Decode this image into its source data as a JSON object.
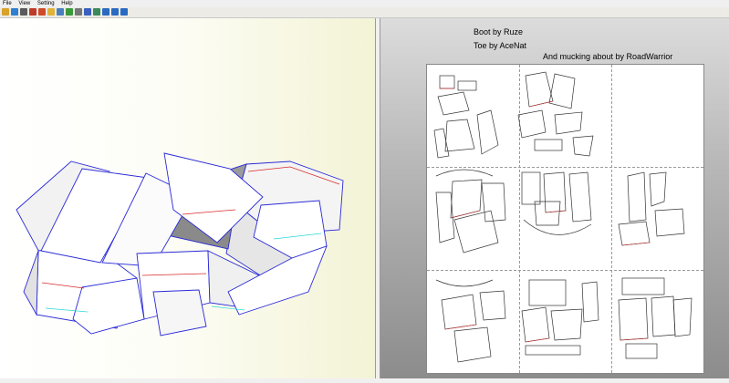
{
  "menu": {
    "file": "File",
    "view": "View",
    "setting": "Setting",
    "help": "Help"
  },
  "toolbar": {
    "buttons": [
      {
        "icon": "open-folder-icon",
        "color": "#d9a22a"
      },
      {
        "icon": "globe-icon",
        "color": "#2f7fd0"
      },
      {
        "icon": "print-icon",
        "color": "#5a5a5a"
      },
      {
        "icon": "export-red-icon",
        "color": "#c03a2a"
      },
      {
        "icon": "color-ball-icon",
        "color": "#d04a2a"
      },
      {
        "icon": "selected-mode-icon",
        "color": "#e0b23a"
      },
      {
        "icon": "grid-icon",
        "color": "#4a7fbf"
      },
      {
        "icon": "pencil-icon",
        "color": "#3a9a3a"
      },
      {
        "icon": "wrench-icon",
        "color": "#777777"
      },
      {
        "icon": "arrow-icon",
        "color": "#3a5fbf"
      },
      {
        "icon": "layout-icon",
        "color": "#3a8a5a"
      },
      {
        "icon": "page-icon",
        "color": "#2a6ac0"
      },
      {
        "icon": "window-icon",
        "color": "#2a6ac0"
      },
      {
        "icon": "info-icon",
        "color": "#2a6ac0"
      }
    ]
  },
  "credits": {
    "line1": "Boot by Ruze",
    "line2": "Toe by AceNat",
    "line3": "And mucking about by RoadWarrior"
  },
  "colors": {
    "edge_blue": "#2a2ad8",
    "edge_red": "#d82a2a",
    "edge_cyan": "#2ad8d8"
  }
}
